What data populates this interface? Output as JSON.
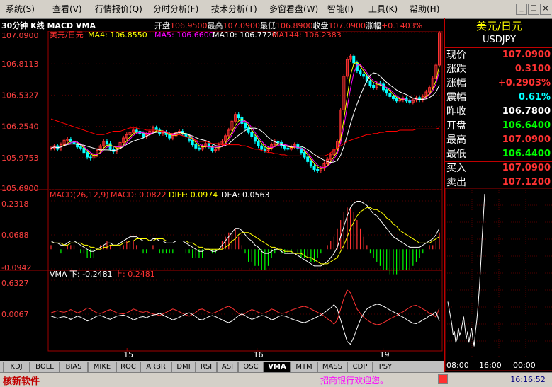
{
  "menu": [
    {
      "label": "系统(S)"
    },
    {
      "label": "查看(V)"
    },
    {
      "label": "行情报价(Q)"
    },
    {
      "label": "分时分析(F)"
    },
    {
      "label": "技术分析(T)"
    },
    {
      "label": "多窗看盘(W)"
    },
    {
      "label": "智能(I)"
    },
    {
      "label": "工具(K)"
    },
    {
      "label": "帮助(H)"
    }
  ],
  "window_controls": {
    "minimize": "_",
    "maximize": "□",
    "close": "×"
  },
  "chart_header": {
    "title": "30分钟 K线 MACD VMA",
    "open_label": "开盘",
    "open": "106.9500",
    "high_label": "最高",
    "high": "107.0900",
    "low_label": "最低",
    "low": "106.8900",
    "close_label": "收盘",
    "close": "107.0900",
    "change_label": "涨幅",
    "change": "+0.1403%"
  },
  "colors": {
    "up": "#ff3232",
    "down": "#00ffff",
    "ma4": "#ffff00",
    "ma5": "#ff00ff",
    "ma10": "#ffffff",
    "ma144": "#ff0000",
    "macd_pos": "#ff3232",
    "macd_neg": "#00ff00",
    "diff": "#ffffff",
    "dea": "#ffff00",
    "vma_down": "#ffffff",
    "vma_up": "#ff3232",
    "grid": "#a00000",
    "axis_text": "#ff4040"
  },
  "chart_data": [
    {
      "type": "candlestick",
      "title": "",
      "series_labels": {
        "symbol": "美元/日元",
        "ma4": "MA4: 106.8550",
        "ma5": "MA5: 106.6600",
        "ma10": "MA10: 106.7720",
        "ma144": "MA144: 106.2383"
      },
      "ylim": [
        105.69,
        107.09
      ],
      "y_ticks": [
        "107.0900",
        "106.8113",
        "106.5327",
        "106.2540",
        "105.9753",
        "105.6900"
      ],
      "x_ticks": [
        {
          "label": "15",
          "at": 0.2
        },
        {
          "label": "16",
          "at": 0.53
        },
        {
          "label": "19",
          "at": 0.85
        }
      ],
      "close": [
        106.06,
        106.08,
        106.05,
        106.09,
        106.13,
        106.14,
        106.12,
        106.1,
        106.07,
        106.06,
        106.02,
        105.98,
        105.97,
        106.0,
        106.04,
        106.08,
        106.12,
        106.1,
        106.05,
        106.03,
        106.06,
        106.11,
        106.15,
        106.18,
        106.2,
        106.22,
        106.21,
        106.19,
        106.16,
        106.18,
        106.21,
        106.24,
        106.22,
        106.19,
        106.2,
        106.18,
        106.15,
        106.17,
        106.2,
        106.21,
        106.19,
        106.16,
        106.13,
        106.09,
        106.06,
        106.05,
        106.08,
        106.1,
        106.07,
        106.04,
        106.05,
        106.09,
        106.12,
        106.17,
        106.22,
        106.3,
        106.36,
        106.33,
        106.28,
        106.24,
        106.2,
        106.16,
        106.12,
        106.08,
        106.05,
        106.04,
        106.06,
        106.09,
        106.12,
        106.11,
        106.08,
        106.06,
        106.05,
        106.07,
        106.09,
        106.06,
        106.02,
        105.98,
        105.94,
        105.9,
        105.87,
        105.86,
        105.88,
        105.92,
        105.96,
        106.0,
        106.05,
        106.12,
        106.4,
        106.7,
        106.85,
        106.88,
        106.82,
        106.75,
        106.72,
        106.7,
        106.66,
        106.62,
        106.6,
        106.64,
        106.63,
        106.58,
        106.55,
        106.52,
        106.5,
        106.48,
        106.49,
        106.5,
        106.48,
        106.47,
        106.49,
        106.51,
        106.49,
        106.52,
        106.56,
        106.6,
        106.68,
        106.8,
        107.09
      ],
      "ma144": [
        106.32,
        106.31,
        106.3,
        106.29,
        106.28,
        106.27,
        106.26,
        106.25,
        106.24,
        106.23,
        106.22,
        106.21,
        106.2,
        106.19,
        106.18,
        106.18,
        106.18,
        106.19,
        106.2,
        106.21,
        106.21,
        106.21,
        106.22,
        106.23,
        106.24,
        106.24,
        106.24,
        106.23,
        106.23,
        106.22,
        106.22,
        106.22,
        106.22,
        106.21,
        106.21,
        106.2,
        106.19,
        106.19,
        106.18,
        106.18,
        106.17,
        106.16,
        106.15,
        106.14,
        106.13,
        106.12,
        106.12,
        106.12,
        106.11,
        106.1,
        106.1,
        106.1,
        106.09,
        106.09,
        106.09,
        106.09,
        106.09,
        106.09,
        106.08,
        106.08,
        106.07,
        106.06,
        106.05,
        106.05,
        106.04,
        106.03,
        106.02,
        106.02,
        106.01,
        106.01,
        106.0,
        106.0,
        105.99,
        105.99,
        105.99,
        105.99,
        105.99,
        105.99,
        105.99,
        105.99,
        105.99,
        105.99,
        105.99,
        105.99,
        106.0,
        106.02,
        106.04,
        106.06,
        106.08,
        106.1,
        106.12,
        106.13,
        106.14,
        106.15,
        106.16,
        106.17,
        106.18,
        106.18,
        106.19,
        106.19,
        106.2,
        106.2,
        106.21,
        106.21,
        106.21,
        106.21,
        106.22,
        106.22,
        106.22,
        106.22,
        106.22,
        106.23,
        106.23,
        106.23,
        106.23,
        106.23,
        106.23,
        106.23,
        106.24
      ]
    },
    {
      "type": "macd",
      "title": "",
      "series_labels": {
        "name": "MACD(26,12,9)",
        "macd": "MACD: 0.0822",
        "diff": "DIFF: 0.0974",
        "dea": "DEA: 0.0563"
      },
      "ylim": [
        -0.0942,
        0.2318
      ],
      "y_ticks": [
        "0.2318",
        "0.0688",
        "-0.0942"
      ],
      "diff": [
        0.04,
        0.03,
        0.03,
        0.02,
        0.02,
        0.03,
        0.04,
        0.04,
        0.03,
        0.02,
        0.01,
        0.0,
        -0.01,
        -0.01,
        0.0,
        0.01,
        0.02,
        0.03,
        0.03,
        0.02,
        0.02,
        0.03,
        0.04,
        0.05,
        0.06,
        0.06,
        0.06,
        0.05,
        0.04,
        0.04,
        0.04,
        0.05,
        0.05,
        0.04,
        0.04,
        0.03,
        0.03,
        0.03,
        0.04,
        0.04,
        0.04,
        0.03,
        0.02,
        0.01,
        0.0,
        -0.01,
        -0.01,
        0.0,
        0.0,
        -0.01,
        -0.01,
        0.0,
        0.02,
        0.04,
        0.06,
        0.08,
        0.1,
        0.1,
        0.09,
        0.07,
        0.05,
        0.04,
        0.02,
        0.01,
        -0.01,
        -0.02,
        -0.02,
        -0.01,
        0.0,
        0.0,
        -0.01,
        -0.02,
        -0.02,
        -0.02,
        -0.02,
        -0.03,
        -0.04,
        -0.05,
        -0.06,
        -0.07,
        -0.08,
        -0.08,
        -0.08,
        -0.07,
        -0.06,
        -0.04,
        -0.02,
        0.01,
        0.06,
        0.11,
        0.16,
        0.2,
        0.22,
        0.23,
        0.23,
        0.22,
        0.21,
        0.19,
        0.17,
        0.16,
        0.14,
        0.12,
        0.1,
        0.08,
        0.06,
        0.05,
        0.04,
        0.03,
        0.02,
        0.01,
        0.01,
        0.01,
        0.01,
        0.02,
        0.03,
        0.04,
        0.05,
        0.07,
        0.1
      ],
      "dea": [
        0.03,
        0.03,
        0.03,
        0.03,
        0.02,
        0.02,
        0.03,
        0.03,
        0.03,
        0.03,
        0.02,
        0.02,
        0.01,
        0.01,
        0.0,
        0.0,
        0.01,
        0.01,
        0.02,
        0.02,
        0.02,
        0.02,
        0.03,
        0.03,
        0.04,
        0.04,
        0.05,
        0.05,
        0.05,
        0.05,
        0.04,
        0.04,
        0.05,
        0.05,
        0.05,
        0.04,
        0.04,
        0.04,
        0.04,
        0.04,
        0.04,
        0.04,
        0.03,
        0.03,
        0.02,
        0.01,
        0.01,
        0.0,
        0.0,
        0.0,
        0.0,
        0.0,
        0.0,
        0.01,
        0.02,
        0.04,
        0.05,
        0.07,
        0.08,
        0.08,
        0.08,
        0.07,
        0.06,
        0.05,
        0.04,
        0.03,
        0.02,
        0.01,
        0.01,
        0.0,
        0.0,
        -0.01,
        -0.01,
        -0.01,
        -0.02,
        -0.02,
        -0.02,
        -0.03,
        -0.04,
        -0.04,
        -0.05,
        -0.06,
        -0.07,
        -0.07,
        -0.07,
        -0.06,
        -0.05,
        -0.04,
        -0.01,
        0.02,
        0.06,
        0.1,
        0.13,
        0.16,
        0.18,
        0.19,
        0.2,
        0.2,
        0.19,
        0.19,
        0.18,
        0.17,
        0.15,
        0.14,
        0.12,
        0.11,
        0.09,
        0.08,
        0.07,
        0.06,
        0.05,
        0.04,
        0.03,
        0.03,
        0.03,
        0.03,
        0.04,
        0.05,
        0.06
      ]
    },
    {
      "type": "line",
      "title": "",
      "series_labels": {
        "name": "VMA",
        "down": "下: -0.2481",
        "up": "上: 0.2481"
      },
      "ylim": [
        -0.62,
        0.6327
      ],
      "y_ticks": [
        "0.6327",
        "0.0067"
      ],
      "up": [
        0.03,
        0.05,
        0.07,
        0.05,
        0.04,
        0.06,
        0.09,
        0.06,
        0.03,
        0.05,
        0.08,
        0.12,
        0.1,
        0.06,
        0.03,
        0.02,
        0.04,
        0.07,
        0.09,
        0.06,
        0.03,
        0.02,
        0.01,
        0.03,
        0.06,
        0.1,
        0.08,
        0.05,
        0.04,
        0.06,
        0.03,
        0.01,
        0.0,
        -0.02,
        0.01,
        0.04,
        0.07,
        0.1,
        0.08,
        0.05,
        0.02,
        -0.01,
        -0.03,
        0.0,
        0.04,
        0.09,
        0.1,
        0.07,
        0.04,
        0.02,
        0.04,
        0.07,
        0.1,
        0.13,
        0.15,
        0.12,
        0.07,
        0.02,
        -0.01,
        0.02,
        0.06,
        0.09,
        0.07,
        0.04,
        0.02,
        0.03,
        0.06,
        0.1,
        0.08,
        0.04,
        0.02,
        0.03,
        0.05,
        0.08,
        0.1,
        0.12,
        0.14,
        0.15,
        0.13,
        0.1,
        0.07,
        0.04,
        0.01,
        -0.03,
        -0.08,
        -0.12,
        -0.18,
        -0.1,
        0.1,
        0.3,
        0.45,
        0.4,
        0.25,
        0.1,
        0.02,
        -0.05,
        -0.1,
        -0.14,
        -0.17,
        -0.19,
        -0.18,
        -0.15,
        -0.12,
        -0.08,
        -0.05,
        -0.02,
        0.02,
        0.05,
        0.09,
        0.13,
        0.16,
        0.17,
        0.14,
        0.1,
        0.07,
        0.02,
        0.0,
        -0.05,
        0.12
      ],
      "down": [
        -0.03,
        -0.05,
        -0.07,
        -0.05,
        -0.04,
        -0.06,
        -0.09,
        -0.06,
        -0.03,
        -0.05,
        -0.08,
        -0.12,
        -0.1,
        -0.06,
        -0.03,
        -0.02,
        -0.04,
        -0.07,
        -0.09,
        -0.06,
        -0.03,
        -0.02,
        -0.01,
        -0.03,
        -0.06,
        -0.1,
        -0.08,
        -0.05,
        -0.04,
        -0.06,
        -0.03,
        -0.01,
        0.0,
        0.02,
        -0.01,
        -0.04,
        -0.07,
        -0.1,
        -0.08,
        -0.05,
        -0.02,
        0.01,
        0.03,
        0.0,
        -0.04,
        -0.09,
        -0.1,
        -0.07,
        -0.04,
        -0.02,
        -0.04,
        -0.07,
        -0.1,
        -0.13,
        -0.15,
        -0.12,
        -0.07,
        -0.02,
        0.01,
        -0.02,
        -0.06,
        -0.09,
        -0.07,
        -0.04,
        -0.02,
        -0.03,
        -0.06,
        -0.1,
        -0.08,
        -0.04,
        -0.02,
        -0.03,
        -0.05,
        -0.08,
        -0.1,
        -0.12,
        -0.14,
        -0.15,
        -0.13,
        -0.1,
        -0.07,
        -0.04,
        -0.01,
        0.03,
        0.08,
        0.12,
        0.18,
        0.1,
        -0.1,
        -0.3,
        -0.5,
        -0.55,
        -0.42,
        -0.25,
        -0.1,
        0.02,
        0.1,
        0.14,
        0.17,
        0.19,
        0.18,
        0.15,
        0.12,
        0.08,
        0.05,
        0.02,
        -0.02,
        -0.05,
        -0.09,
        -0.13,
        -0.16,
        -0.17,
        -0.14,
        -0.1,
        -0.07,
        -0.02,
        0.0,
        0.05,
        -0.12
      ]
    },
    {
      "type": "line",
      "title": "",
      "x_ticks": [
        "08:00",
        "16:00",
        "00:00"
      ],
      "ylim": [
        105.69,
        107.09
      ],
      "values": [
        106.8,
        106.78,
        106.76,
        106.74,
        106.71,
        106.72,
        106.69,
        106.7,
        106.73,
        106.71,
        106.72,
        106.74,
        106.76,
        106.73,
        106.7,
        106.72,
        106.69,
        106.71,
        106.73,
        106.7,
        106.68,
        106.72,
        106.75,
        106.79,
        106.84,
        106.9,
        106.97,
        107.03,
        107.09
      ]
    }
  ],
  "tabs": [
    {
      "label": "KDJ"
    },
    {
      "label": "BOLL"
    },
    {
      "label": "BIAS"
    },
    {
      "label": "MIKE"
    },
    {
      "label": "ROC"
    },
    {
      "label": "ARBR"
    },
    {
      "label": "DMI"
    },
    {
      "label": "RSI"
    },
    {
      "label": "ASI"
    },
    {
      "label": "OSC"
    },
    {
      "label": "VMA",
      "active": true
    },
    {
      "label": "MTM"
    },
    {
      "label": "MASS"
    },
    {
      "label": "CDP"
    },
    {
      "label": "PSY"
    }
  ],
  "status": {
    "brand": "核新软件",
    "message": "招商银行欢迎您。",
    "time": "16:16:52"
  },
  "quote": {
    "name": "美元/日元",
    "code": "USDJPY",
    "rows": [
      {
        "label": "现价",
        "value": "107.0900",
        "color": "#ff3232"
      },
      {
        "label": "涨跌",
        "value": "0.3100",
        "color": "#ff3232"
      },
      {
        "label": "涨幅",
        "value": "+0.2903%",
        "color": "#ff3232"
      },
      {
        "label": "震幅",
        "value": "0.61%",
        "color": "#00ffff"
      },
      {
        "label": "昨收",
        "value": "106.7800",
        "color": "#ffffff"
      },
      {
        "label": "开盘",
        "value": "106.6400",
        "color": "#00ff00"
      },
      {
        "label": "最高",
        "value": "107.0900",
        "color": "#ff3232"
      },
      {
        "label": "最低",
        "value": "106.4400",
        "color": "#00ff00"
      },
      {
        "label": "买入",
        "value": "107.0900",
        "color": "#ff3232"
      },
      {
        "label": "卖出",
        "value": "107.1200",
        "color": "#ff3232"
      }
    ]
  }
}
